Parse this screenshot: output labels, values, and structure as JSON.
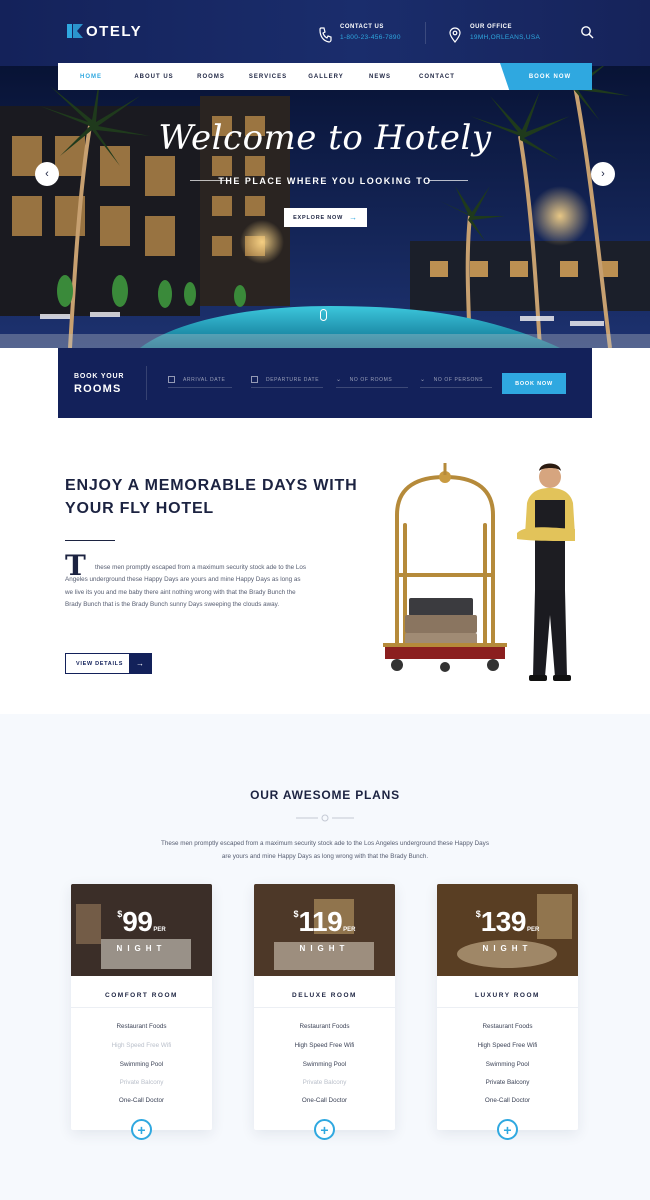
{
  "header": {
    "logo_text": "OTELY",
    "contact_label": "CONTACT US",
    "contact_value": "1-800-23-456-7890",
    "office_label": "OUR OFFICE",
    "office_value": "19MH,ORLEANS,USA"
  },
  "nav": {
    "items": [
      "HOME",
      "ABOUT US",
      "ROOMS",
      "SERVICES",
      "GALLERY",
      "NEWS",
      "CONTACT"
    ],
    "active_index": 0,
    "book_label": "BOOK NOW"
  },
  "hero": {
    "title": "Welcome to Hotely",
    "subtitle": "THE PLACE WHERE YOU LOOKING TO",
    "button_label": "EXPLORE NOW",
    "button_arrow": "→",
    "prev_arrow": "‹",
    "next_arrow": "›"
  },
  "booking": {
    "title_small": "BOOK YOUR",
    "title_big": "ROOMS",
    "arrival_placeholder": "ARRIVAL DATE",
    "departure_placeholder": "DEPARTURE DATE",
    "rooms_placeholder": "NO OF ROOMS",
    "persons_placeholder": "NO OF PERSONS",
    "button_label": "BOOK NOW"
  },
  "about": {
    "title_line1": "ENJOY A MEMORABLE DAYS WITH",
    "title_line2": "YOUR FLY HOTEL",
    "dropcap": "T",
    "body": "these men promptly escaped from a maximum security stock ade to the Los Angeles underground these Happy Days are yours and mine Happy Days as long as we live its you and me baby there aint nothing wrong with that the Brady Bunch the Brady Bunch that is the Brady Bunch sunny Days sweeping the clouds away.",
    "button_label": "VIEW DETAILS",
    "button_arrow": "→"
  },
  "plans": {
    "title": "OUR AWESOME PLANS",
    "description": "These men promptly escaped from a maximum security stock ade to the Los Angeles underground these Happy Days are yours and mine Happy Days as long wrong with that the Brady Bunch.",
    "cards": [
      {
        "currency": "$",
        "price": "99",
        "per": "PER",
        "unit": "NIGHT",
        "name": "COMFORT ROOM",
        "features": [
          "Restaurant Foods",
          "High Speed Free Wifi",
          "Swimming Pool",
          "Private Balcony",
          "One-Call Doctor"
        ],
        "muted": [
          false,
          true,
          false,
          true,
          false
        ],
        "plus": "+"
      },
      {
        "currency": "$",
        "price": "119",
        "per": "PER",
        "unit": "NIGHT",
        "name": "DELUXE ROOM",
        "features": [
          "Restaurant Foods",
          "High Speed Free Wifi",
          "Swimming Pool",
          "Private Balcony",
          "One-Call Doctor"
        ],
        "muted": [
          false,
          false,
          false,
          true,
          false
        ],
        "plus": "+"
      },
      {
        "currency": "$",
        "price": "139",
        "per": "PER",
        "unit": "NIGHT",
        "name": "LUXURY ROOM",
        "features": [
          "Restaurant Foods",
          "High Speed Free Wifi",
          "Swimming Pool",
          "Private Balcony",
          "One-Call Doctor"
        ],
        "muted": [
          false,
          false,
          false,
          false,
          false
        ],
        "plus": "+"
      }
    ]
  },
  "colors": {
    "navy": "#13215a",
    "accent": "#2fa8e0",
    "text_dark": "#1c2341"
  }
}
